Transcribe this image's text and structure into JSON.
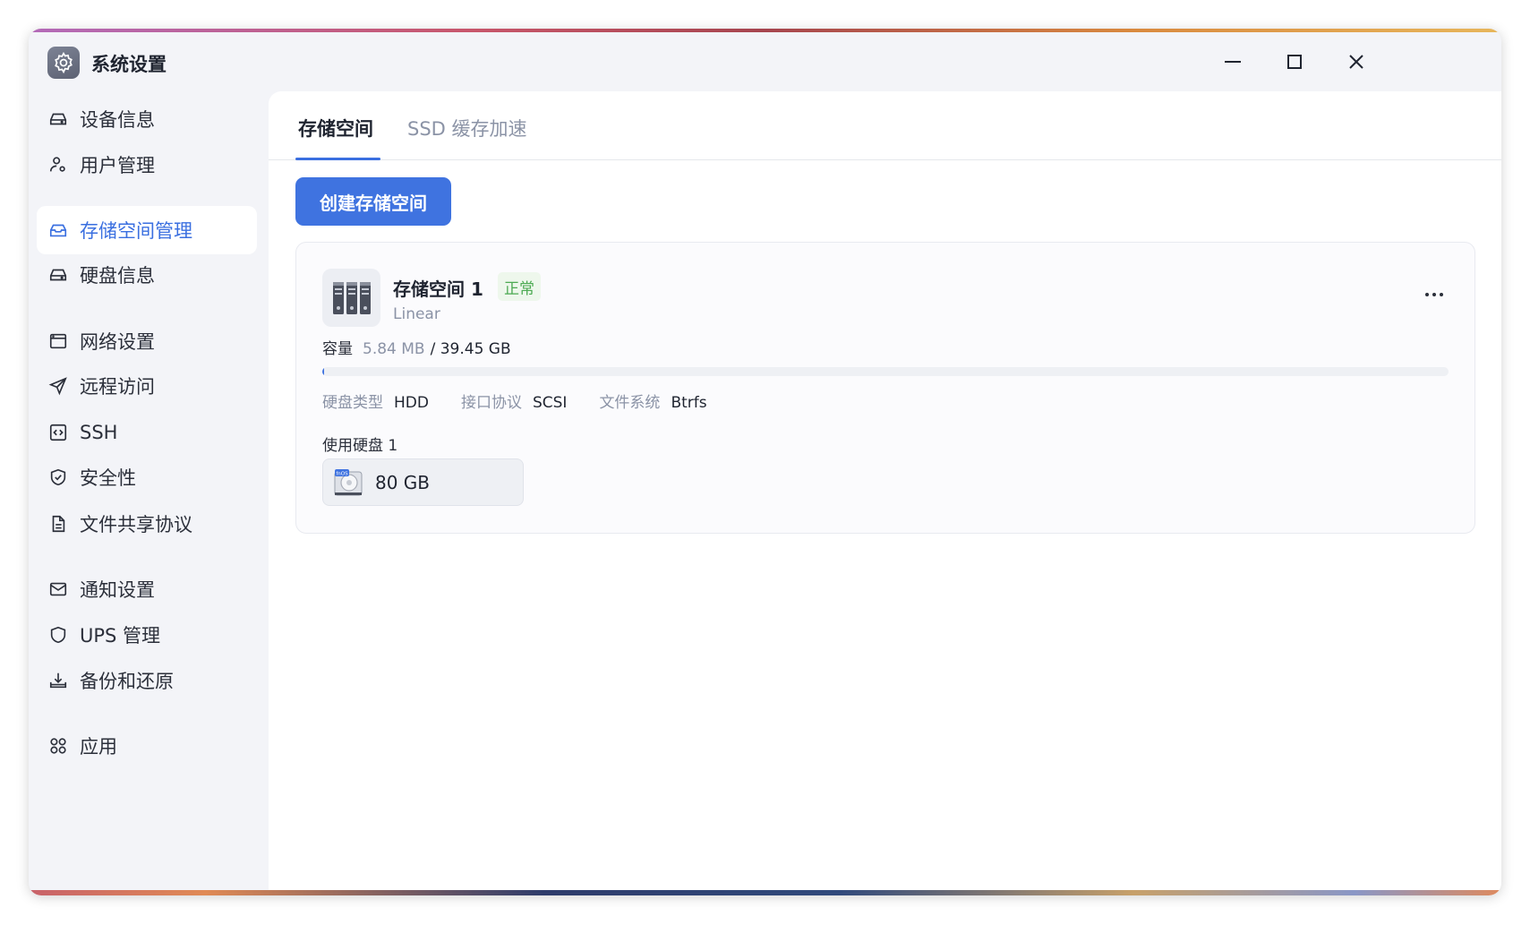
{
  "window": {
    "title": "系统设置",
    "icon": "gear-icon"
  },
  "controls": {
    "minimize_icon": "minimize-icon",
    "maximize_icon": "maximize-icon",
    "close_icon": "close-icon"
  },
  "sidebar": {
    "items": [
      {
        "label": "设备信息",
        "icon": "drive-icon",
        "active": false
      },
      {
        "label": "用户管理",
        "icon": "user-gear-icon",
        "active": false
      },
      {
        "label": "存储空间管理",
        "icon": "storage-tray-icon",
        "active": true
      },
      {
        "label": "硬盘信息",
        "icon": "hard-disk-icon",
        "active": false
      },
      {
        "label": "网络设置",
        "icon": "browser-window-icon",
        "active": false
      },
      {
        "label": "远程访问",
        "icon": "paper-plane-icon",
        "active": false
      },
      {
        "label": "SSH",
        "icon": "code-box-icon",
        "active": false
      },
      {
        "label": "安全性",
        "icon": "shield-check-icon",
        "active": false
      },
      {
        "label": "文件共享协议",
        "icon": "document-icon",
        "active": false
      },
      {
        "label": "通知设置",
        "icon": "mail-icon",
        "active": false
      },
      {
        "label": "UPS 管理",
        "icon": "shield-icon",
        "active": false
      },
      {
        "label": "备份和还原",
        "icon": "download-tray-icon",
        "active": false
      },
      {
        "label": "应用",
        "icon": "apps-grid-icon",
        "active": false
      }
    ]
  },
  "tabs": [
    {
      "label": "存储空间",
      "active": true
    },
    {
      "label": "SSD 缓存加速",
      "active": false
    }
  ],
  "actions": {
    "create_label": "创建存储空间"
  },
  "storage_space": {
    "name": "存储空间 1",
    "status": "正常",
    "type": "Linear",
    "capacity_label": "容量",
    "used": "5.84 MB",
    "total": "/ 39.45 GB",
    "usage_fraction": 0.0002,
    "disk_type_label": "硬盘类型",
    "disk_type": "HDD",
    "interface_label": "接口协议",
    "interface": "SCSI",
    "filesystem_label": "文件系统",
    "filesystem": "Btrfs",
    "disks_label": "使用硬盘 1",
    "disks": [
      {
        "size": "80 GB",
        "brand": "fnOS"
      }
    ]
  },
  "colors": {
    "accent": "#3f73e0",
    "status_ok": "#4caa52"
  }
}
